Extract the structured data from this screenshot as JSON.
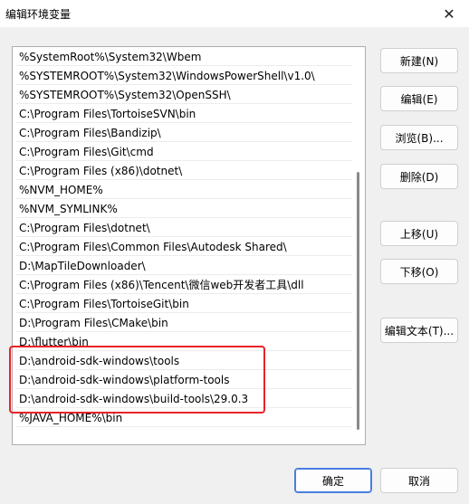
{
  "window": {
    "title": "编辑环境变量",
    "close_glyph": "✕"
  },
  "list": {
    "items": [
      "%SystemRoot%\\System32\\Wbem",
      "%SYSTEMROOT%\\System32\\WindowsPowerShell\\v1.0\\",
      "%SYSTEMROOT%\\System32\\OpenSSH\\",
      "C:\\Program Files\\TortoiseSVN\\bin",
      "C:\\Program Files\\Bandizip\\",
      "C:\\Program Files\\Git\\cmd",
      "C:\\Program Files (x86)\\dotnet\\",
      "%NVM_HOME%",
      "%NVM_SYMLINK%",
      "C:\\Program Files\\dotnet\\",
      "C:\\Program Files\\Common Files\\Autodesk Shared\\",
      "D:\\MapTileDownloader\\",
      "C:\\Program Files (x86)\\Tencent\\微信web开发者工具\\dll",
      "C:\\Program Files\\TortoiseGit\\bin",
      "D:\\Program Files\\CMake\\bin",
      "D:\\flutter\\bin",
      "D:\\android-sdk-windows\\tools",
      "D:\\android-sdk-windows\\platform-tools",
      "D:\\android-sdk-windows\\build-tools\\29.0.3",
      "%JAVA_HOME%\\bin"
    ]
  },
  "buttons": {
    "new": "新建(N)",
    "edit": "编辑(E)",
    "browse": "浏览(B)...",
    "delete": "删除(D)",
    "move_up": "上移(U)",
    "move_down": "下移(O)",
    "edit_text": "编辑文本(T)...",
    "ok": "确定",
    "cancel": "取消"
  },
  "colors": {
    "highlight": "#e8232b",
    "accent": "#4a7ee0"
  }
}
